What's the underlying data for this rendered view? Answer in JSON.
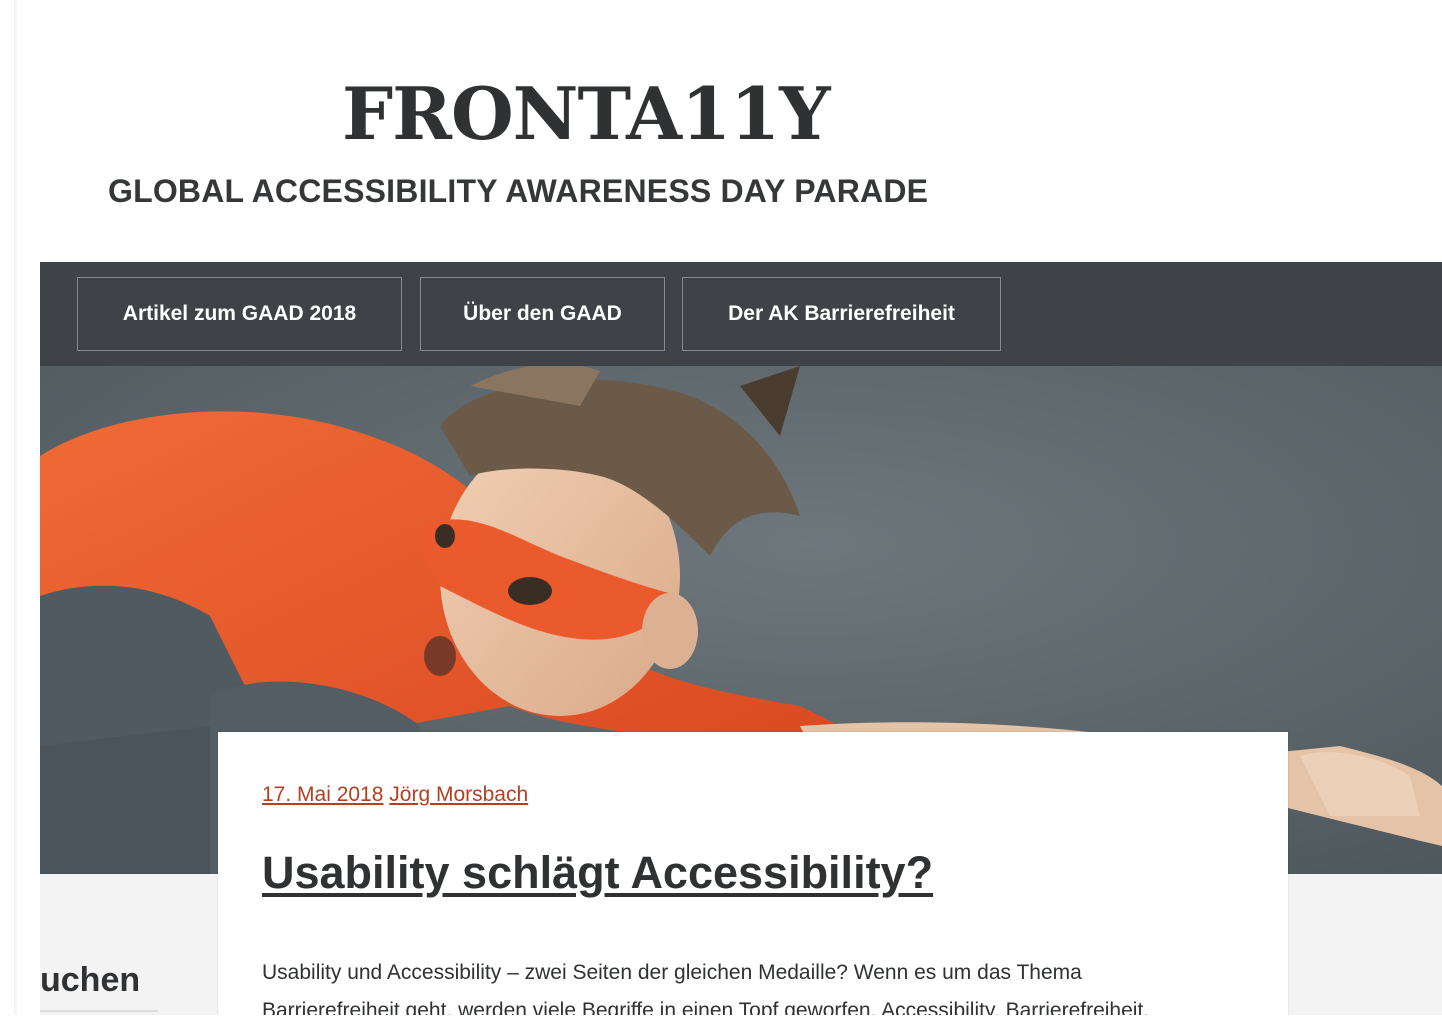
{
  "site": {
    "title": "FRONTA11Y",
    "tagline": "GLOBAL ACCESSIBILITY AWARENESS DAY PARADE"
  },
  "nav": {
    "items": [
      {
        "label": "Artikel zum GAAD 2018"
      },
      {
        "label": "Über den GAAD"
      },
      {
        "label": "Der AK Barrierefreiheit"
      }
    ]
  },
  "hero": {
    "description_icon": "superhero-child-hero-image"
  },
  "sidebar": {
    "search_heading_partial": "uchen"
  },
  "post": {
    "date": "17. Mai 2018",
    "author": "Jörg Morsbach",
    "title": "Usability schlägt Accessibility?",
    "excerpt_line1": "Usability und Accessibility – zwei Seiten der gleichen Medaille? Wenn es um das Thema",
    "excerpt_line2": "Barrierefreiheit geht, werden viele Begriffe in einen Topf geworfen. Accessibility, Barrierefreiheit,"
  },
  "colors": {
    "nav_bg": "#3f4347",
    "link": "#b5401f",
    "text": "#2f3133",
    "cape": "#e8542a"
  }
}
